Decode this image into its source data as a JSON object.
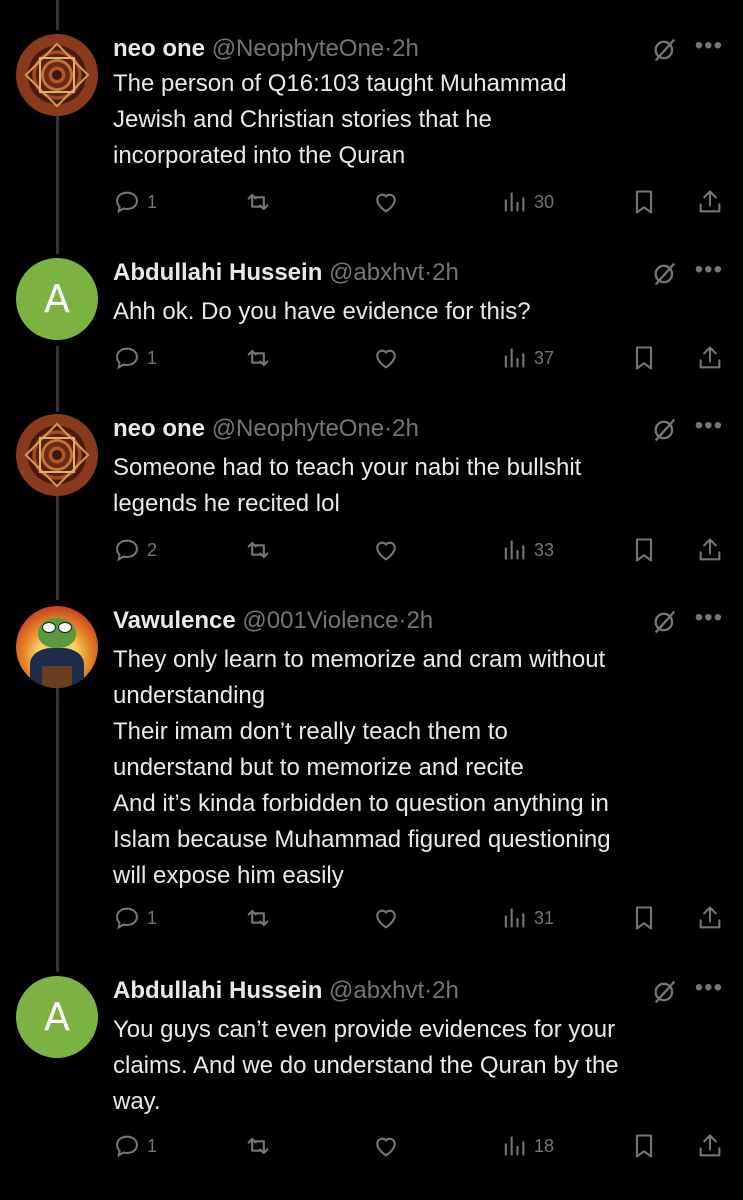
{
  "tweets": [
    {
      "avatar_type": "mandala",
      "name": "neo one",
      "handle": "@NeophyteOne",
      "dot": "·",
      "time": "2h",
      "text": "The person of Q16:103 taught Muhammad\nJewish and Christian stories that he\nincorporated into the Quran",
      "replies": "1",
      "views": "30"
    },
    {
      "avatar_type": "letter",
      "avatar_letter": "A",
      "name": "Abdullahi Hussein",
      "handle": "@abxhvt",
      "dot": "·",
      "time": "2h",
      "text": "Ahh ok. Do you have evidence for this?",
      "replies": "1",
      "views": "37"
    },
    {
      "avatar_type": "mandala",
      "name": "neo one",
      "handle": "@NeophyteOne",
      "dot": "·",
      "time": "2h",
      "text": "Someone had to teach your nabi the bullshit\nlegends he recited lol",
      "replies": "2",
      "views": "33"
    },
    {
      "avatar_type": "pepe",
      "name": "Vawulence",
      "handle": "@001Violence",
      "dot": "·",
      "time": "2h",
      "text": "They only learn to memorize and cram without\nunderstanding\nTheir imam don’t really teach them to\nunderstand but to memorize and recite\nAnd it’s kinda forbidden to question anything in\nIslam because Muhammad figured questioning\nwill expose him easily",
      "replies": "1",
      "views": "31"
    },
    {
      "avatar_type": "letter",
      "avatar_letter": "A",
      "name": "Abdullahi Hussein",
      "handle": "@abxhvt",
      "dot": "·",
      "time": "2h",
      "text": "You guys can’t even provide evidences for your\nclaims. And we do understand the Quran by the\nway.",
      "replies": "1",
      "views": "18"
    }
  ],
  "icons": {
    "reply": "reply-icon",
    "repost": "repost-icon",
    "like": "like-icon",
    "views": "views-icon",
    "bookmark": "bookmark-icon",
    "share": "share-icon",
    "grok": "grok-icon",
    "more": "more-icon"
  },
  "colors": {
    "background": "#000000",
    "text": "#e7e9ea",
    "secondary": "#71767b",
    "thread_line": "#333639",
    "letter_avatar": "#7cb342"
  }
}
